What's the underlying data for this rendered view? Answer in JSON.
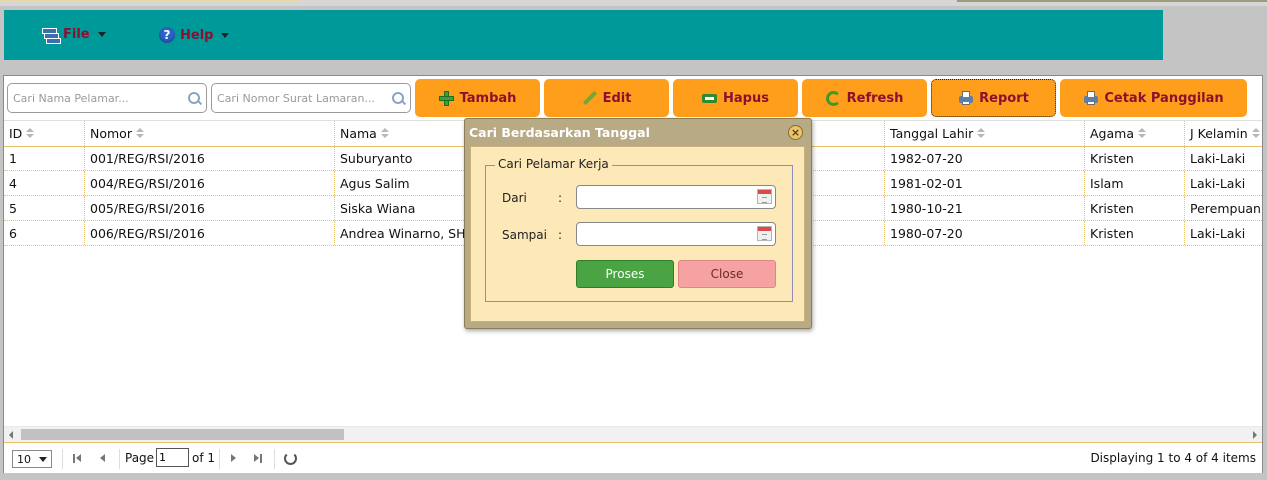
{
  "menu": {
    "items": [
      {
        "label": "File",
        "icon": "file-icon"
      },
      {
        "label": "Help",
        "icon": "help-icon"
      }
    ]
  },
  "toolbar": {
    "search_name_placeholder": "Cari Nama Pelamar...",
    "search_number_placeholder": "Cari Nomor Surat Lamaran...",
    "buttons": [
      {
        "label": "Tambah",
        "icon": "plus-icon"
      },
      {
        "label": "Edit",
        "icon": "pencil-icon"
      },
      {
        "label": "Hapus",
        "icon": "minus-icon"
      },
      {
        "label": "Refresh",
        "icon": "refresh-icon"
      },
      {
        "label": "Report",
        "icon": "printer-icon"
      },
      {
        "label": "Cetak Panggilan",
        "icon": "printer-icon"
      }
    ]
  },
  "grid": {
    "columns": [
      "ID",
      "Nomor",
      "Nama",
      "Tanggal Lahir",
      "Agama",
      "J Kelamin"
    ],
    "rows": [
      {
        "id": "1",
        "nomor": "001/REG/RSI/2016",
        "nama": "Suburyanto",
        "tanggal_lahir": "1982-07-20",
        "agama": "Kristen",
        "jk": "Laki-Laki"
      },
      {
        "id": "4",
        "nomor": "004/REG/RSI/2016",
        "nama": "Agus Salim",
        "tanggal_lahir": "1981-02-01",
        "agama": "Islam",
        "jk": "Laki-Laki"
      },
      {
        "id": "5",
        "nomor": "005/REG/RSI/2016",
        "nama": "Siska Wiana",
        "tanggal_lahir": "1980-10-21",
        "agama": "Kristen",
        "jk": "Perempuan"
      },
      {
        "id": "6",
        "nomor": "006/REG/RSI/2016",
        "nama": "Andrea Winarno, SH",
        "tanggal_lahir": "1980-07-20",
        "agama": "Kristen",
        "jk": "Laki-Laki"
      }
    ]
  },
  "pager": {
    "page_size": "10",
    "page_label": "Page",
    "page_value": "1",
    "of_label": "of 1",
    "display_text": "Displaying 1 to 4 of 4 items"
  },
  "dialog": {
    "title": "Cari Berdasarkan Tanggal",
    "fieldset_legend": "Cari Pelamar Kerja",
    "from_label": "Dari",
    "to_label": "Sampai",
    "colon": ":",
    "proses_label": "Proses",
    "close_label": "Close"
  },
  "colors": {
    "menubar": "#009999",
    "toolbar_button": "#ff9e1a",
    "button_text": "#8b1030",
    "dialog_header": "#b7aa84",
    "dialog_body": "#fde9b8",
    "proses_button": "#4aa444",
    "close_button": "#f7a2a2"
  }
}
